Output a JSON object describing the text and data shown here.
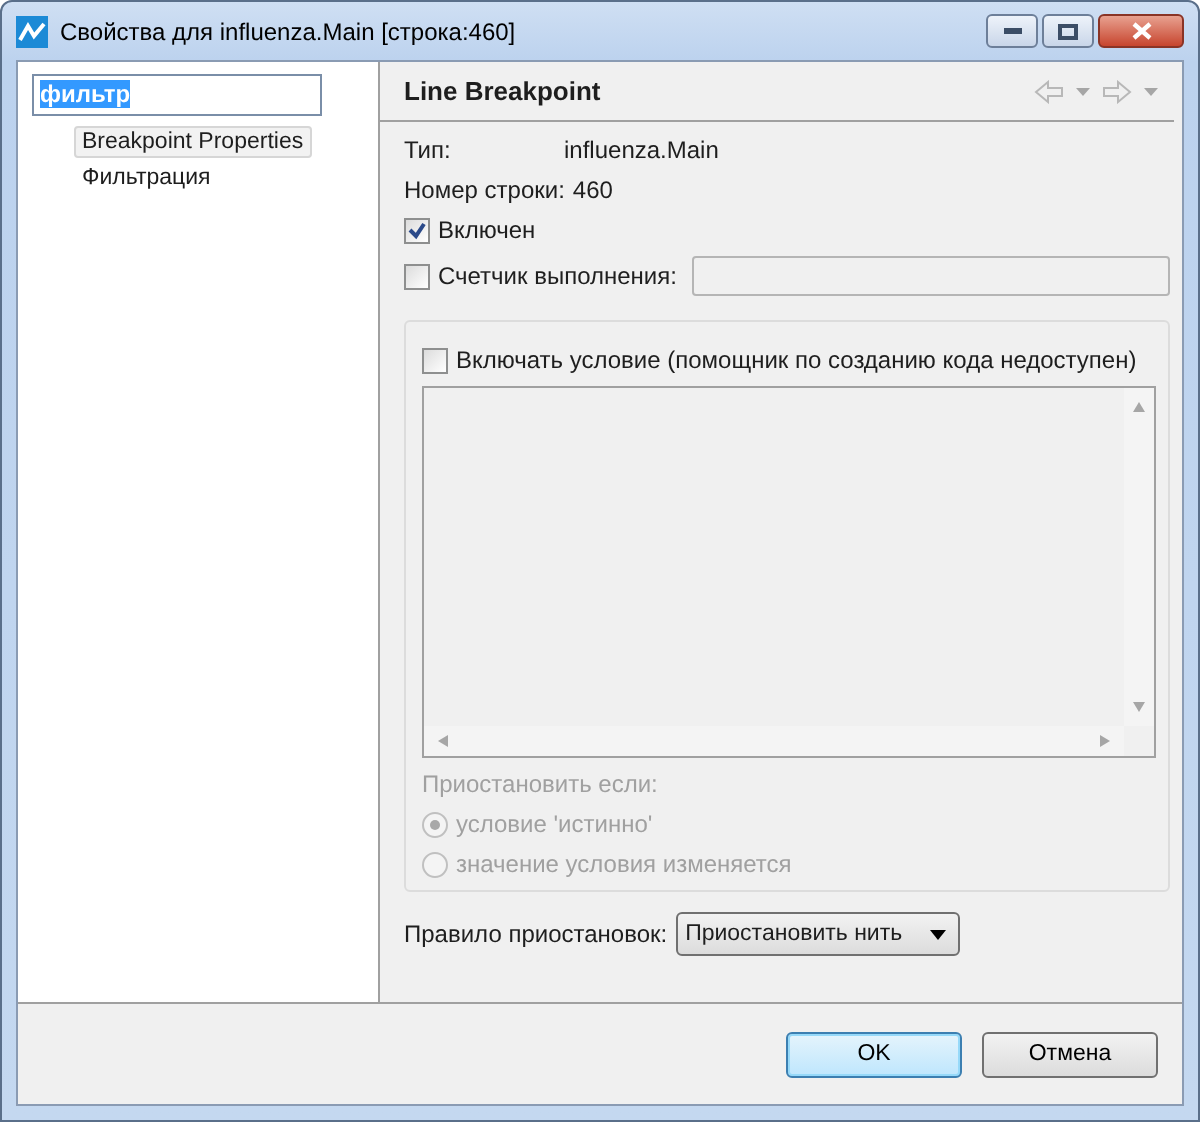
{
  "window": {
    "title": "Свойства для influenza.Main [строка:460]"
  },
  "sidebar": {
    "filter": {
      "value": "фильтр",
      "text_selected": true
    },
    "items": [
      {
        "label": "Breakpoint Properties",
        "selected": true
      },
      {
        "label": "Фильтрация",
        "selected": false
      }
    ]
  },
  "page": {
    "title": "Line Breakpoint"
  },
  "fields": [
    {
      "label": "Тип:",
      "value": "influenza.Main"
    },
    {
      "label": "Номер строки:",
      "value": "460"
    }
  ],
  "enabled": {
    "label": "Включен",
    "checked": true
  },
  "hit_count": {
    "label": "Счетчик выполнения:",
    "checked": false
  },
  "condition": {
    "label": "Включать условие (помощник по созданию кода недоступен)",
    "checked": false,
    "disabled": true,
    "suspend_label": "Приостановить если:",
    "options": [
      {
        "label": "условие 'истинно'",
        "selected": true
      },
      {
        "label": "значение условия изменяется",
        "selected": false
      }
    ]
  },
  "suspend_policy": {
    "label": "Правило приостановок:",
    "value": "Приостановить нить"
  },
  "buttons": [
    {
      "label": "OK",
      "default": true
    },
    {
      "label": "Отмена",
      "default": false
    }
  ]
}
